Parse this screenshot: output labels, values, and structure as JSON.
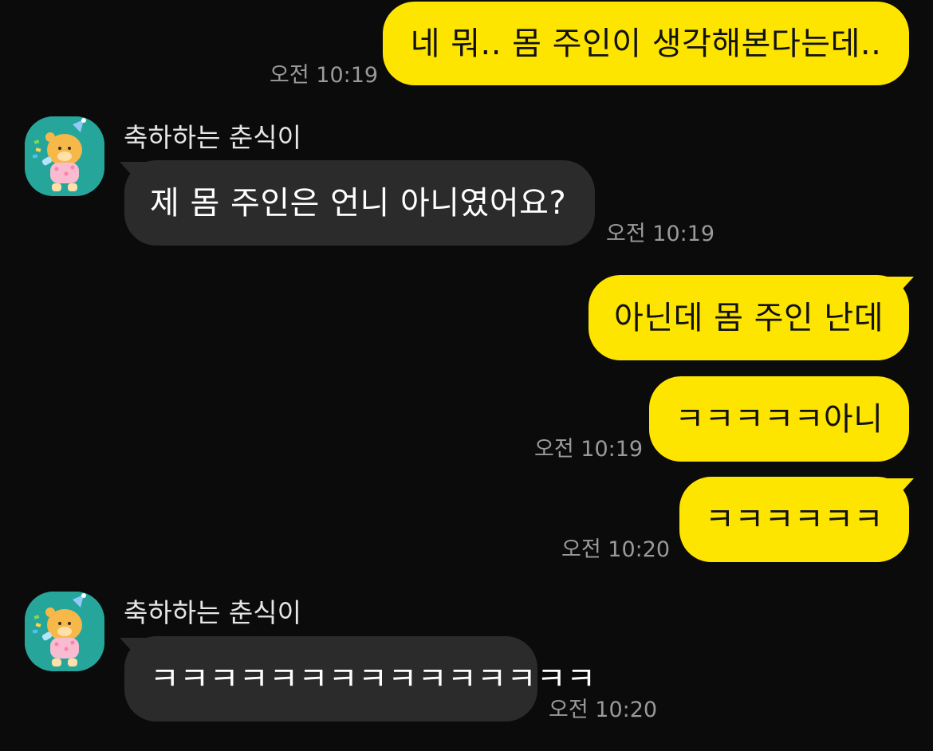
{
  "colors": {
    "background": "#0b0b0b",
    "my_bubble": "#fee500",
    "their_bubble": "#2b2b2b",
    "avatar_bg": "#26a69a",
    "timestamp": "#9a9a9a"
  },
  "messages": [
    {
      "from": "me",
      "text": "네 뭐.. 몸 주인이 생각해본다는데..",
      "time": "오전 10:19"
    },
    {
      "from": "other",
      "sender": "축하하는 춘식이",
      "avatar_icon": "choonsik-party-avatar",
      "text": "제 몸 주인은 언니 아니였어요?",
      "time": "오전 10:19"
    },
    {
      "from": "me",
      "text": "아닌데 몸 주인 난데"
    },
    {
      "from": "me",
      "text": "ㅋㅋㅋㅋㅋ아니",
      "time": "오전 10:19"
    },
    {
      "from": "me",
      "text": "ㅋㅋㅋㅋㅋㅋ",
      "time": "오전 10:20"
    },
    {
      "from": "other",
      "sender": "축하하는 춘식이",
      "avatar_icon": "choonsik-party-avatar",
      "text": "ㅋㅋㅋㅋㅋㅋㅋㅋㅋㅋㅋㅋㅋㅋㅋ",
      "time": "오전 10:20"
    }
  ]
}
